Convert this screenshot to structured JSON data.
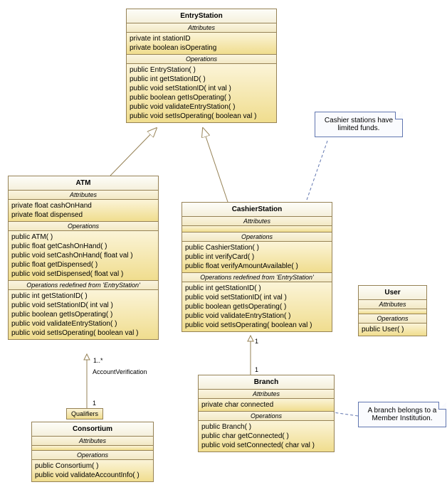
{
  "entryStation": {
    "name": "EntryStation",
    "attrHeader": "Attributes",
    "attrs": [
      "private int stationID",
      "private boolean isOperating"
    ],
    "opHeader": "Operations",
    "ops": [
      "public EntryStation(  )",
      "public int  getStationID(  )",
      "public void  setStationID( int val )",
      "public boolean  getIsOperating(  )",
      "public void  validateEntryStation(  )",
      "public void  setIsOperating( boolean val )"
    ]
  },
  "atm": {
    "name": "ATM",
    "attrHeader": "Attributes",
    "attrs": [
      "private float cashOnHand",
      "private float dispensed"
    ],
    "opHeader": "Operations",
    "ops": [
      "public ATM(  )",
      "public float  getCashOnHand(  )",
      "public void  setCashOnHand( float val )",
      "public float  getDispensed(  )",
      "public void  setDispensed( float val )"
    ],
    "redefHeader": "Operations redefined from 'EntryStation'",
    "redefOps": [
      "public int  getStationID(  )",
      "public void  setStationID( int val )",
      "public boolean  getIsOperating(  )",
      "public void  validateEntryStation(  )",
      "public void  setIsOperating( boolean val )"
    ]
  },
  "cashierStation": {
    "name": "CashierStation",
    "attrHeader": "Attributes",
    "opHeader": "Operations",
    "ops": [
      "public CashierStation(  )",
      "public int  verifyCard(  )",
      "public float  verifyAmountAvailable(  )"
    ],
    "redefHeader": "Operations redefined from 'EntryStation'",
    "redefOps": [
      "public int  getStationID(  )",
      "public void  setStationID( int val )",
      "public boolean  getIsOperating(  )",
      "public void  validateEntryStation(  )",
      "public void  setIsOperating( boolean val )"
    ]
  },
  "user": {
    "name": "User",
    "attrHeader": "Attributes",
    "opHeader": "Operations",
    "ops": [
      "public User(  )"
    ]
  },
  "branch": {
    "name": "Branch",
    "attrHeader": "Attributes",
    "attrs": [
      "private char connected"
    ],
    "opHeader": "Operations",
    "ops": [
      "public Branch(  )",
      "public char  getConnected(  )",
      "public void  setConnected( char val )"
    ]
  },
  "consortium": {
    "name": "Consortium",
    "attrHeader": "Attributes",
    "opHeader": "Operations",
    "ops": [
      "public Consortium(  )",
      "public void  validateAccountInfo(  )"
    ]
  },
  "qualifier": "Qualifiers",
  "assocLabel": "AccountVerification",
  "mult": {
    "atmTop": "1..*",
    "consortium": "1",
    "cashier": "1",
    "branch": "1"
  },
  "note1": "Cashier stations have limited funds.",
  "note2": "A branch belongs to a Member Institution.",
  "chart_data": {
    "type": "uml-class-diagram",
    "classes": [
      "EntryStation",
      "ATM",
      "CashierStation",
      "User",
      "Branch",
      "Consortium"
    ],
    "generalizations": [
      {
        "child": "ATM",
        "parent": "EntryStation"
      },
      {
        "child": "CashierStation",
        "parent": "EntryStation"
      }
    ],
    "associations": [
      {
        "from": "ATM",
        "to": "Consortium",
        "name": "AccountVerification",
        "fromMult": "1..*",
        "toMult": "1",
        "qualifier": "Qualifiers"
      },
      {
        "from": "CashierStation",
        "to": "Branch",
        "fromMult": "1",
        "toMult": "1"
      }
    ],
    "notes": [
      {
        "text": "Cashier stations have limited funds.",
        "attachedTo": "CashierStation"
      },
      {
        "text": "A branch belongs to a Member Institution.",
        "attachedTo": "Branch"
      }
    ]
  }
}
